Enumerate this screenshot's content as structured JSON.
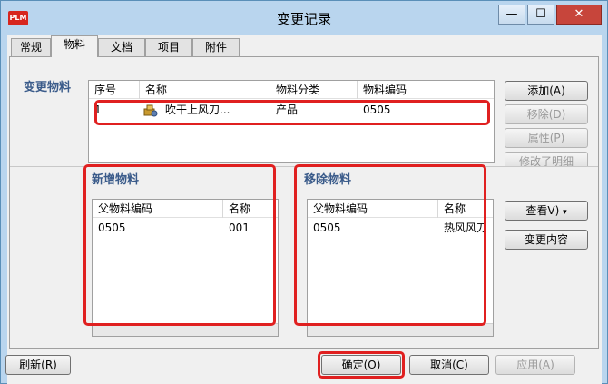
{
  "window": {
    "title": "变更记录",
    "app_icon_text": "PLM"
  },
  "tabs": [
    "常规",
    "物料",
    "文档",
    "项目",
    "附件"
  ],
  "active_tab": "物料",
  "change_material": {
    "label": "变更物料",
    "columns": [
      "序号",
      "名称",
      "物料分类",
      "物料编码"
    ],
    "rows": [
      {
        "index": "1",
        "name": "吹干上风刀...",
        "category": "产品",
        "code": "0505"
      }
    ]
  },
  "side_buttons": {
    "add": "添加(A)",
    "remove": "移除(D)",
    "properties": "属性(P)",
    "change_detail": "修改了明细"
  },
  "added_material": {
    "label": "新增物料",
    "columns": [
      "父物料编码",
      "名称"
    ],
    "rows": [
      {
        "parent_code": "0505",
        "name": "001"
      }
    ]
  },
  "removed_material": {
    "label": "移除物料",
    "columns": [
      "父物料编码",
      "名称"
    ],
    "rows": [
      {
        "parent_code": "0505",
        "name": "热风风刀"
      }
    ]
  },
  "view_button": "查看V)",
  "change_content_button": "变更内容",
  "footer": {
    "refresh": "刷新(R)",
    "ok": "确定(O)",
    "cancel": "取消(C)",
    "apply": "应用(A)"
  },
  "colors": {
    "highlight": "#e02020",
    "title_bar": "#b9d5ee",
    "section_label": "#3a5b8a"
  }
}
